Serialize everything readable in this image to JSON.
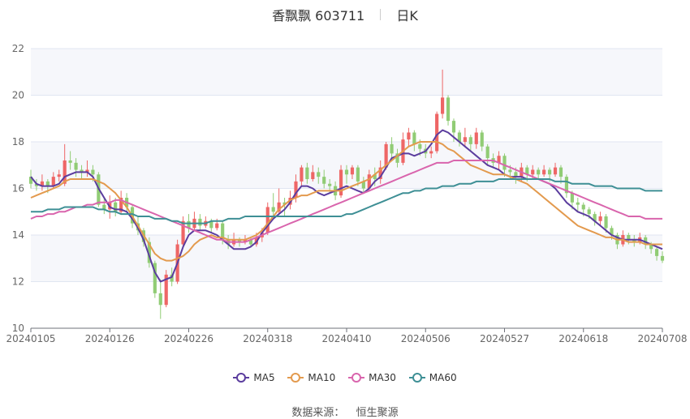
{
  "title": {
    "name": "香飘飘 603711",
    "period": "日K"
  },
  "source_label": "数据来源：",
  "source_value": "恒生聚源",
  "colors": {
    "up": "#ee6666",
    "down": "#91cc75",
    "MA5": "#5b3d9e",
    "MA10": "#e39a4e",
    "MA30": "#d965ad",
    "MA60": "#3e8f95",
    "grid": "#e0e6f1",
    "band": "#f6f7fb"
  },
  "chart_data": {
    "type": "candlestick",
    "ylim": [
      10,
      22
    ],
    "y_ticks": [
      10,
      12,
      14,
      16,
      18,
      20,
      22
    ],
    "x_ticks": [
      {
        "label": "20240105",
        "index": 0
      },
      {
        "label": "20240126",
        "index": 14
      },
      {
        "label": "20240226",
        "index": 28
      },
      {
        "label": "20240318",
        "index": 42
      },
      {
        "label": "20240410",
        "index": 56
      },
      {
        "label": "20240506",
        "index": 70
      },
      {
        "label": "20240527",
        "index": 84
      },
      {
        "label": "20240618",
        "index": 98
      },
      {
        "label": "20240708",
        "index": 112
      }
    ],
    "candles": [
      [
        16.5,
        16.2,
        16.8,
        16.0
      ],
      [
        16.2,
        16.1,
        16.4,
        15.9
      ],
      [
        16.1,
        16.3,
        16.6,
        15.9
      ],
      [
        16.3,
        16.1,
        16.4,
        15.8
      ],
      [
        16.1,
        16.5,
        16.7,
        16.0
      ],
      [
        16.5,
        16.6,
        16.8,
        16.3
      ],
      [
        16.2,
        17.2,
        17.9,
        16.1
      ],
      [
        17.2,
        17.1,
        17.6,
        16.8
      ],
      [
        17.1,
        16.8,
        17.3,
        16.5
      ],
      [
        16.8,
        16.7,
        17.0,
        16.4
      ],
      [
        16.7,
        16.8,
        17.2,
        16.5
      ],
      [
        16.8,
        16.6,
        17.0,
        16.3
      ],
      [
        16.6,
        15.3,
        16.7,
        15.2
      ],
      [
        15.3,
        15.1,
        15.6,
        14.9
      ],
      [
        15.1,
        15.4,
        15.7,
        14.7
      ],
      [
        15.4,
        15.0,
        15.6,
        14.8
      ],
      [
        15.0,
        15.6,
        15.9,
        14.9
      ],
      [
        15.6,
        15.2,
        15.8,
        15.0
      ],
      [
        15.2,
        14.5,
        15.3,
        14.3
      ],
      [
        14.5,
        14.2,
        14.8,
        14.0
      ],
      [
        14.2,
        13.7,
        14.3,
        13.5
      ],
      [
        13.7,
        12.8,
        13.9,
        12.6
      ],
      [
        12.8,
        11.5,
        12.9,
        11.3
      ],
      [
        11.5,
        11.0,
        12.1,
        10.4
      ],
      [
        11.0,
        12.3,
        12.5,
        10.9
      ],
      [
        12.3,
        12.0,
        12.6,
        11.8
      ],
      [
        12.0,
        13.6,
        13.8,
        11.9
      ],
      [
        13.6,
        14.6,
        14.8,
        13.5
      ],
      [
        14.6,
        14.3,
        14.9,
        14.1
      ],
      [
        14.3,
        14.7,
        15.0,
        14.2
      ],
      [
        14.7,
        14.4,
        14.9,
        14.2
      ],
      [
        14.4,
        14.6,
        14.8,
        14.3
      ],
      [
        14.6,
        14.3,
        14.7,
        14.1
      ],
      [
        14.3,
        14.5,
        14.7,
        14.2
      ],
      [
        14.5,
        13.8,
        14.6,
        13.6
      ],
      [
        13.8,
        13.6,
        14.0,
        13.4
      ],
      [
        13.6,
        13.8,
        14.1,
        13.5
      ],
      [
        13.8,
        13.7,
        13.9,
        13.5
      ],
      [
        13.7,
        13.8,
        14.0,
        13.6
      ],
      [
        13.8,
        13.6,
        13.9,
        13.5
      ],
      [
        13.6,
        13.9,
        14.1,
        13.5
      ],
      [
        13.9,
        14.1,
        14.3,
        13.7
      ],
      [
        14.1,
        15.2,
        15.4,
        14.0
      ],
      [
        15.2,
        15.0,
        15.8,
        14.8
      ],
      [
        15.0,
        15.4,
        16.0,
        14.9
      ],
      [
        15.4,
        15.3,
        15.6,
        14.8
      ],
      [
        15.3,
        15.6,
        15.9,
        15.1
      ],
      [
        15.6,
        16.3,
        16.6,
        15.4
      ],
      [
        16.3,
        16.9,
        17.0,
        16.1
      ],
      [
        16.9,
        16.4,
        17.1,
        16.2
      ],
      [
        16.4,
        16.7,
        17.0,
        16.3
      ],
      [
        16.7,
        16.5,
        16.9,
        16.2
      ],
      [
        16.5,
        16.2,
        16.8,
        16.0
      ],
      [
        16.2,
        16.1,
        16.4,
        15.8
      ],
      [
        16.1,
        15.7,
        16.3,
        15.5
      ],
      [
        15.7,
        16.8,
        17.0,
        15.6
      ],
      [
        16.8,
        16.6,
        17.0,
        16.2
      ],
      [
        16.6,
        16.9,
        17.0,
        16.4
      ],
      [
        16.9,
        16.3,
        17.0,
        16.1
      ],
      [
        16.3,
        16.0,
        16.5,
        15.8
      ],
      [
        16.0,
        16.6,
        16.8,
        15.9
      ],
      [
        16.6,
        16.4,
        16.9,
        16.1
      ],
      [
        16.4,
        16.9,
        17.2,
        16.2
      ],
      [
        16.9,
        17.9,
        18.0,
        16.8
      ],
      [
        17.9,
        17.5,
        18.2,
        17.2
      ],
      [
        17.5,
        17.1,
        17.7,
        16.9
      ],
      [
        17.1,
        18.1,
        18.4,
        17.0
      ],
      [
        18.1,
        18.4,
        18.6,
        17.8
      ],
      [
        18.4,
        17.9,
        18.5,
        17.6
      ],
      [
        17.9,
        17.7,
        18.1,
        17.4
      ],
      [
        17.7,
        17.5,
        17.9,
        17.3
      ],
      [
        17.5,
        17.6,
        17.8,
        17.3
      ],
      [
        17.6,
        19.2,
        19.3,
        17.5
      ],
      [
        19.2,
        19.9,
        21.1,
        19.0
      ],
      [
        19.9,
        18.9,
        20.0,
        18.7
      ],
      [
        18.9,
        18.4,
        19.0,
        18.0
      ],
      [
        18.4,
        18.0,
        18.5,
        17.8
      ],
      [
        18.0,
        18.2,
        18.6,
        17.8
      ],
      [
        18.2,
        17.9,
        18.3,
        17.6
      ],
      [
        17.9,
        18.4,
        18.6,
        17.7
      ],
      [
        18.4,
        17.8,
        18.5,
        17.6
      ],
      [
        17.8,
        17.3,
        17.9,
        17.0
      ],
      [
        17.3,
        17.1,
        17.5,
        16.9
      ],
      [
        17.1,
        17.4,
        17.6,
        16.8
      ],
      [
        17.4,
        16.8,
        17.5,
        16.5
      ],
      [
        16.8,
        16.7,
        17.0,
        16.4
      ],
      [
        16.7,
        16.5,
        16.9,
        16.2
      ],
      [
        16.5,
        16.9,
        17.1,
        16.3
      ],
      [
        16.9,
        16.6,
        17.0,
        16.3
      ],
      [
        16.6,
        16.8,
        17.0,
        16.4
      ],
      [
        16.8,
        16.6,
        16.9,
        16.4
      ],
      [
        16.6,
        16.8,
        17.0,
        16.5
      ],
      [
        16.8,
        16.6,
        16.9,
        16.3
      ],
      [
        16.6,
        16.9,
        17.1,
        16.5
      ],
      [
        16.9,
        16.5,
        17.0,
        16.2
      ],
      [
        16.5,
        15.8,
        16.6,
        15.6
      ],
      [
        15.8,
        15.4,
        15.9,
        15.1
      ],
      [
        15.4,
        15.3,
        15.6,
        15.0
      ],
      [
        15.3,
        15.1,
        15.4,
        14.8
      ],
      [
        15.1,
        14.9,
        15.2,
        14.7
      ],
      [
        14.9,
        14.6,
        15.0,
        14.4
      ],
      [
        14.6,
        14.8,
        15.0,
        14.4
      ],
      [
        14.8,
        14.3,
        14.9,
        14.1
      ],
      [
        14.3,
        14.0,
        14.4,
        13.8
      ],
      [
        14.0,
        13.6,
        14.1,
        13.4
      ],
      [
        13.6,
        14.0,
        14.2,
        13.5
      ],
      [
        14.0,
        13.8,
        14.1,
        13.6
      ],
      [
        13.8,
        13.7,
        14.0,
        13.5
      ],
      [
        13.7,
        13.9,
        14.1,
        13.6
      ],
      [
        13.9,
        13.6,
        14.0,
        13.4
      ],
      [
        13.6,
        13.4,
        13.7,
        13.2
      ],
      [
        13.4,
        13.1,
        13.5,
        12.9
      ],
      [
        13.1,
        12.9,
        13.3,
        12.8
      ]
    ],
    "series": [
      {
        "name": "MA5",
        "values": [
          16.5,
          16.2,
          16.1,
          16.1,
          16.1,
          16.2,
          16.5,
          16.6,
          16.7,
          16.7,
          16.7,
          16.5,
          16.0,
          15.6,
          15.2,
          15.1,
          15.1,
          15.0,
          14.7,
          14.3,
          13.8,
          13.1,
          12.4,
          12.0,
          12.1,
          12.2,
          12.8,
          13.5,
          14.0,
          14.2,
          14.2,
          14.2,
          14.1,
          14.0,
          13.8,
          13.6,
          13.4,
          13.4,
          13.4,
          13.5,
          13.7,
          14.1,
          14.4,
          14.7,
          14.9,
          15.1,
          15.4,
          15.8,
          16.1,
          16.1,
          16.0,
          15.8,
          15.7,
          15.8,
          15.9,
          16.0,
          16.1,
          16.0,
          15.9,
          15.8,
          16.0,
          16.3,
          16.5,
          16.9,
          17.3,
          17.4,
          17.5,
          17.5,
          17.4,
          17.5,
          17.6,
          17.9,
          18.3,
          18.5,
          18.4,
          18.2,
          18.0,
          17.8,
          17.6,
          17.4,
          17.2,
          17.0,
          16.9,
          16.8,
          16.6,
          16.5,
          16.5,
          16.5,
          16.4,
          16.4,
          16.4,
          16.3,
          16.2,
          16.0,
          15.7,
          15.4,
          15.2,
          15.0,
          14.9,
          14.8,
          14.6,
          14.4,
          14.2,
          14.0,
          13.9,
          13.8,
          13.8,
          13.8,
          13.8,
          13.7,
          13.6,
          13.5,
          13.4
        ]
      },
      {
        "name": "MA10",
        "values": [
          15.6,
          15.7,
          15.8,
          15.9,
          16.0,
          16.1,
          16.3,
          16.4,
          16.4,
          16.4,
          16.4,
          16.4,
          16.3,
          16.2,
          16.0,
          15.8,
          15.5,
          15.2,
          14.8,
          14.4,
          14.0,
          13.6,
          13.2,
          13.0,
          12.9,
          12.9,
          13.0,
          13.1,
          13.3,
          13.6,
          13.8,
          13.9,
          14.0,
          13.9,
          13.9,
          13.8,
          13.8,
          13.8,
          13.8,
          13.9,
          14.0,
          14.2,
          14.5,
          14.8,
          15.1,
          15.3,
          15.5,
          15.6,
          15.7,
          15.7,
          15.8,
          15.9,
          15.9,
          15.9,
          15.9,
          15.9,
          16.0,
          16.1,
          16.2,
          16.3,
          16.4,
          16.6,
          16.8,
          17.0,
          17.2,
          17.4,
          17.6,
          17.8,
          17.9,
          18.0,
          18.0,
          18.0,
          18.0,
          17.9,
          17.7,
          17.6,
          17.4,
          17.2,
          17.0,
          16.9,
          16.8,
          16.7,
          16.6,
          16.6,
          16.6,
          16.5,
          16.4,
          16.3,
          16.2,
          16.0,
          15.8,
          15.6,
          15.4,
          15.2,
          15.0,
          14.8,
          14.6,
          14.4,
          14.3,
          14.2,
          14.1,
          14.0,
          13.9,
          13.9,
          13.8,
          13.8,
          13.7,
          13.7,
          13.7,
          13.6,
          13.6,
          13.6,
          13.6
        ]
      },
      {
        "name": "MA30",
        "values": [
          14.7,
          14.8,
          14.8,
          14.9,
          14.9,
          15.0,
          15.0,
          15.1,
          15.2,
          15.2,
          15.3,
          15.3,
          15.4,
          15.4,
          15.4,
          15.5,
          15.5,
          15.4,
          15.3,
          15.2,
          15.1,
          15.0,
          14.9,
          14.8,
          14.7,
          14.6,
          14.5,
          14.4,
          14.3,
          14.2,
          14.1,
          14.0,
          13.9,
          13.8,
          13.8,
          13.7,
          13.7,
          13.7,
          13.7,
          13.8,
          13.9,
          14.0,
          14.1,
          14.2,
          14.3,
          14.4,
          14.5,
          14.6,
          14.7,
          14.8,
          14.9,
          15.0,
          15.1,
          15.2,
          15.3,
          15.4,
          15.5,
          15.6,
          15.7,
          15.8,
          15.9,
          16.0,
          16.1,
          16.2,
          16.3,
          16.4,
          16.5,
          16.6,
          16.7,
          16.8,
          16.9,
          17.0,
          17.1,
          17.1,
          17.1,
          17.2,
          17.2,
          17.2,
          17.2,
          17.2,
          17.2,
          17.2,
          17.2,
          17.1,
          17.0,
          16.9,
          16.8,
          16.7,
          16.6,
          16.5,
          16.4,
          16.3,
          16.2,
          16.1,
          16.0,
          15.9,
          15.8,
          15.7,
          15.6,
          15.5,
          15.4,
          15.3,
          15.2,
          15.1,
          15.0,
          14.9,
          14.8,
          14.8,
          14.8,
          14.7,
          14.7,
          14.7,
          14.7
        ]
      },
      {
        "name": "MA60",
        "values": [
          15.0,
          15.0,
          15.0,
          15.1,
          15.1,
          15.1,
          15.2,
          15.2,
          15.2,
          15.2,
          15.2,
          15.2,
          15.1,
          15.1,
          15.0,
          15.0,
          14.9,
          14.9,
          14.9,
          14.8,
          14.8,
          14.8,
          14.7,
          14.7,
          14.7,
          14.6,
          14.6,
          14.5,
          14.5,
          14.5,
          14.5,
          14.5,
          14.6,
          14.6,
          14.6,
          14.7,
          14.7,
          14.7,
          14.8,
          14.8,
          14.8,
          14.8,
          14.8,
          14.8,
          14.8,
          14.8,
          14.8,
          14.8,
          14.8,
          14.8,
          14.8,
          14.8,
          14.8,
          14.8,
          14.8,
          14.8,
          14.9,
          14.9,
          15.0,
          15.1,
          15.2,
          15.3,
          15.4,
          15.5,
          15.6,
          15.7,
          15.8,
          15.8,
          15.9,
          15.9,
          16.0,
          16.0,
          16.0,
          16.1,
          16.1,
          16.1,
          16.2,
          16.2,
          16.2,
          16.3,
          16.3,
          16.3,
          16.3,
          16.4,
          16.4,
          16.4,
          16.4,
          16.4,
          16.4,
          16.4,
          16.4,
          16.4,
          16.4,
          16.3,
          16.3,
          16.3,
          16.2,
          16.2,
          16.2,
          16.2,
          16.1,
          16.1,
          16.1,
          16.1,
          16.0,
          16.0,
          16.0,
          16.0,
          16.0,
          15.9,
          15.9,
          15.9,
          15.9
        ]
      }
    ]
  }
}
